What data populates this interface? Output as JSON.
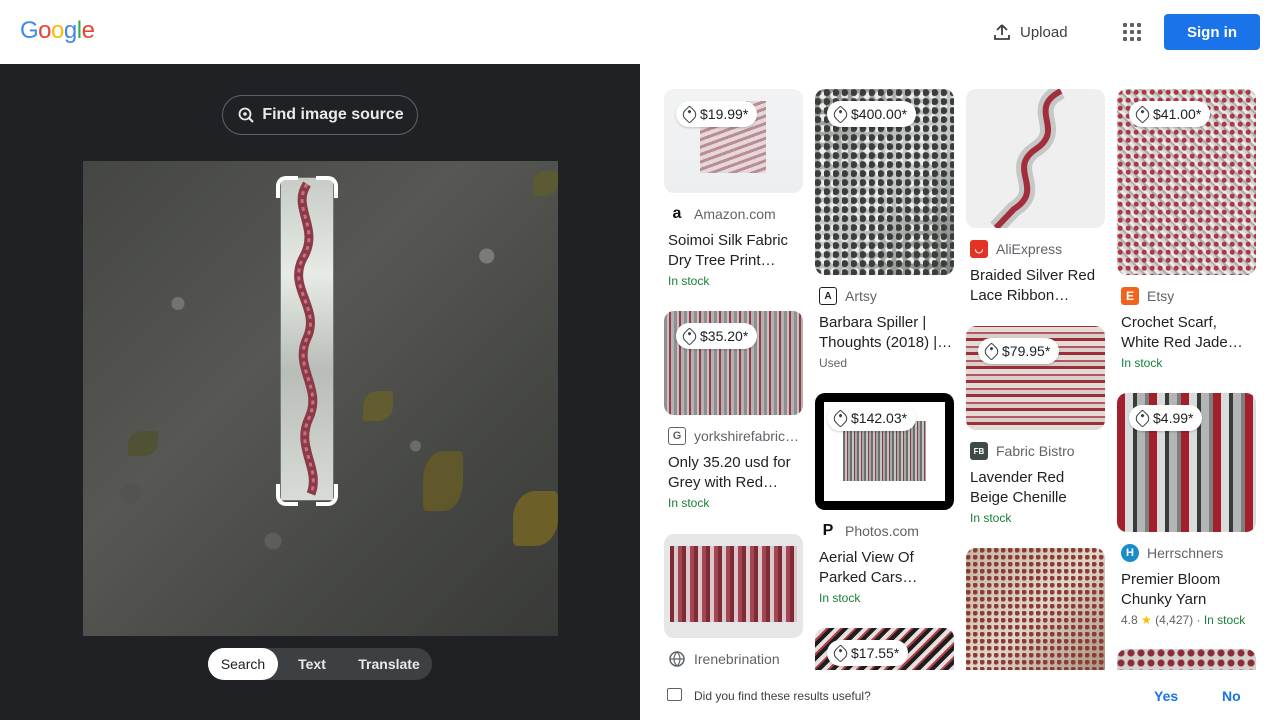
{
  "header": {
    "logo": [
      "G",
      "o",
      "o",
      "g",
      "l",
      "e"
    ],
    "logo_colors": [
      "#4285f4",
      "#ea4335",
      "#fbbc05",
      "#4285f4",
      "#34a853",
      "#ea4335"
    ],
    "upload_label": "Upload",
    "apps_icon": "apps-grid-icon",
    "signin_label": "Sign in"
  },
  "lens": {
    "find_source_label": "Find image source",
    "modes": [
      "Search",
      "Text",
      "Translate"
    ],
    "active_mode": "Search"
  },
  "results": {
    "col1": [
      {
        "price": "$19.99*",
        "source": "Amazon.com",
        "title": "Soimoi Silk Fabric Dry Tree Print…",
        "status": "In stock",
        "favicon": "amazon-icon"
      },
      {
        "price": "$35.20*",
        "source": "yorkshirefabric…",
        "title": "Only 35.20 usd for Grey with Red…",
        "status": "In stock",
        "favicon": "yorkshire-icon"
      },
      {
        "price": "",
        "source": "Irenebrination",
        "title": "",
        "status": "",
        "favicon": "globe-icon"
      }
    ],
    "col2": [
      {
        "price": "$400.00*",
        "source": "Artsy",
        "title": "Barbara Spiller | Thoughts (2018) |…",
        "status": "Used",
        "favicon": "artsy-icon"
      },
      {
        "price": "$142.03*",
        "source": "Photos.com",
        "title": "Aerial View Of Parked Cars…",
        "status": "In stock",
        "favicon": "photos-icon"
      },
      {
        "price": "$17.55*",
        "source": "",
        "title": "",
        "status": "",
        "favicon": ""
      }
    ],
    "col3": [
      {
        "price": "",
        "source": "AliExpress",
        "title": "Braided Silver Red Lace Ribbon…",
        "status": "",
        "favicon": "aliexpress-icon"
      },
      {
        "price": "$79.95*",
        "source": "Fabric Bistro",
        "title": "Lavender Red Beige Chenille Up…",
        "status": "In stock",
        "favicon": "fabricbistro-icon"
      }
    ],
    "col4": [
      {
        "price": "$41.00*",
        "source": "Etsy",
        "title": "Crochet Scarf, White Red Jade…",
        "status": "In stock",
        "favicon": "etsy-icon"
      },
      {
        "price": "$4.99*",
        "source": "Herrschners",
        "title": "Premier Bloom Chunky Yarn",
        "rating": "4.8",
        "reviews": "(4,427)",
        "status": "In stock",
        "favicon": "herrschners-icon"
      }
    ]
  },
  "feedback": {
    "question": "Did you find these results useful?",
    "yes": "Yes",
    "no": "No"
  }
}
